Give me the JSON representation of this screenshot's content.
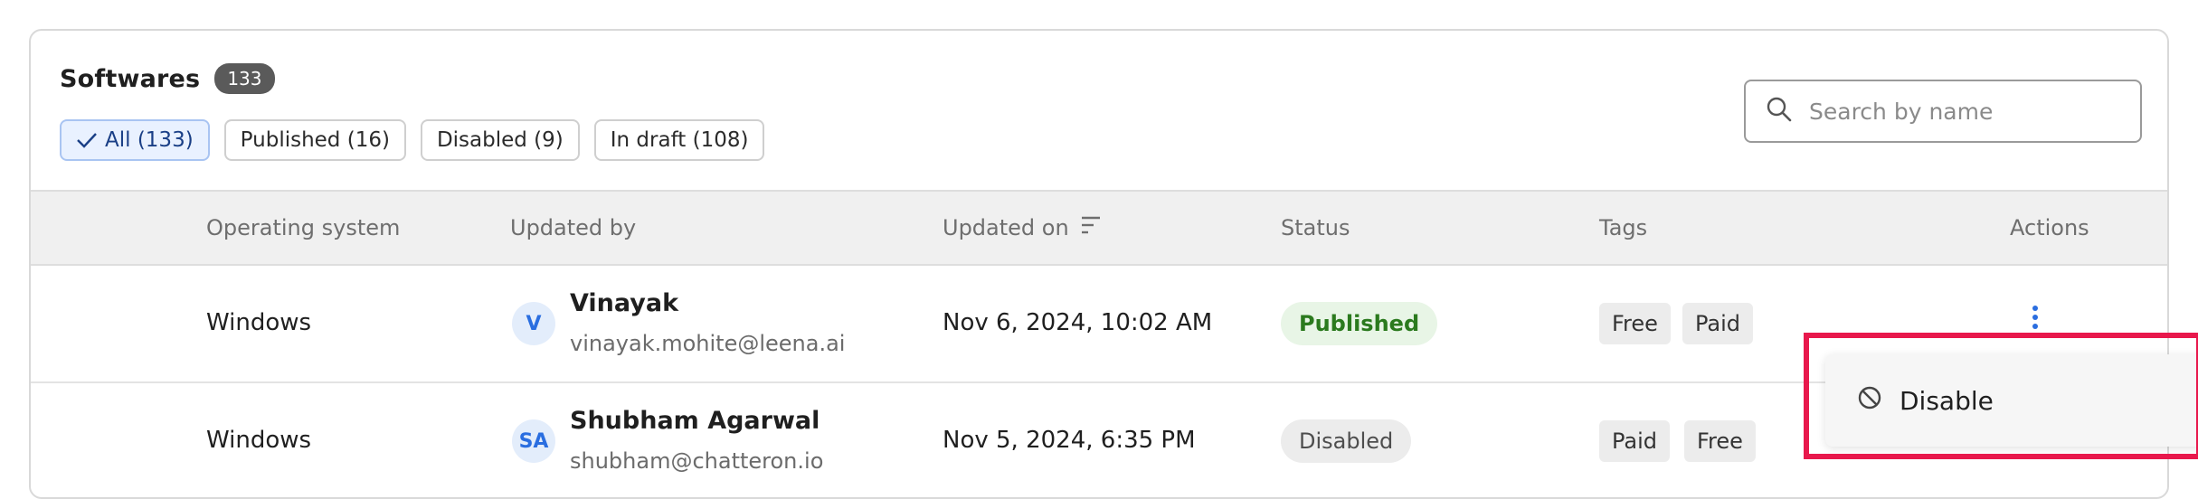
{
  "header": {
    "title": "Softwares",
    "count": "133"
  },
  "filters": [
    {
      "label": "All (133)",
      "active": true
    },
    {
      "label": "Published (16)",
      "active": false
    },
    {
      "label": "Disabled (9)",
      "active": false
    },
    {
      "label": "In draft (108)",
      "active": false
    }
  ],
  "search": {
    "placeholder": "Search by name",
    "icon": "search-icon"
  },
  "table": {
    "columns": {
      "os": "Operating system",
      "updated_by": "Updated by",
      "updated_on": "Updated on",
      "status": "Status",
      "tags": "Tags",
      "actions": "Actions"
    },
    "rows": [
      {
        "os": "Windows",
        "avatar": "V",
        "name": "Vinayak",
        "email": "vinayak.mohite@leena.ai",
        "updated_on": "Nov 6, 2024, 10:02 AM",
        "status": "Published",
        "tags": [
          "Free",
          "Paid"
        ]
      },
      {
        "os": "Windows",
        "avatar": "SA",
        "name": "Shubham Agarwal",
        "email": "shubham@chatteron.io",
        "updated_on": "Nov 5, 2024, 6:35 PM",
        "status": "Disabled",
        "tags": [
          "Paid",
          "Free"
        ]
      }
    ]
  },
  "action_menu": {
    "items": [
      {
        "label": "Disable",
        "icon": "ban-icon"
      }
    ]
  },
  "colors": {
    "accent": "#2a6ee0",
    "highlight": "#e8184c",
    "published_bg": "#e8f5e6",
    "published_text": "#2b7a1e"
  }
}
